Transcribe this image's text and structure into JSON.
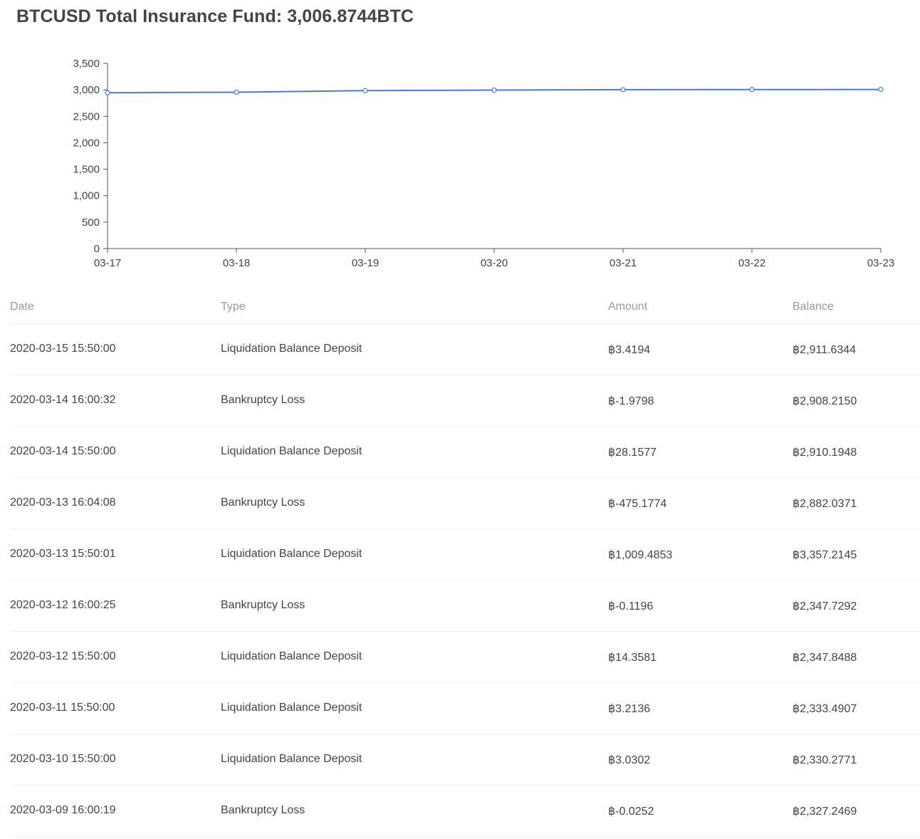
{
  "header": {
    "title": "BTCUSD Total Insurance Fund: 3,006.8744BTC"
  },
  "chart_data": {
    "type": "line",
    "title": "",
    "xlabel": "",
    "ylabel": "",
    "categories": [
      "03-17",
      "03-18",
      "03-19",
      "03-20",
      "03-21",
      "03-22",
      "03-23"
    ],
    "values": [
      2945,
      2955,
      2985,
      2995,
      3003,
      3005,
      3007
    ],
    "yticks": [
      "0",
      "500",
      "1,000",
      "1,500",
      "2,000",
      "2,500",
      "3,000",
      "3,500"
    ],
    "ylim": [
      0,
      3500
    ],
    "grid": false,
    "legend": "none",
    "line_color": "#4a7bd0"
  },
  "table": {
    "columns": [
      "Date",
      "Type",
      "Amount",
      "Balance"
    ],
    "rows": [
      {
        "date": "2020-03-15 15:50:00",
        "type": "Liquidation Balance Deposit",
        "amount": "฿3.4194",
        "balance": "฿2,911.6344"
      },
      {
        "date": "2020-03-14 16:00:32",
        "type": "Bankruptcy Loss",
        "amount": "฿-1.9798",
        "balance": "฿2,908.2150"
      },
      {
        "date": "2020-03-14 15:50:00",
        "type": "Liquidation Balance Deposit",
        "amount": "฿28.1577",
        "balance": "฿2,910.1948"
      },
      {
        "date": "2020-03-13 16:04:08",
        "type": "Bankruptcy Loss",
        "amount": "฿-475.1774",
        "balance": "฿2,882.0371"
      },
      {
        "date": "2020-03-13 15:50:01",
        "type": "Liquidation Balance Deposit",
        "amount": "฿1,009.4853",
        "balance": "฿3,357.2145"
      },
      {
        "date": "2020-03-12 16:00:25",
        "type": "Bankruptcy Loss",
        "amount": "฿-0.1196",
        "balance": "฿2,347.7292"
      },
      {
        "date": "2020-03-12 15:50:00",
        "type": "Liquidation Balance Deposit",
        "amount": "฿14.3581",
        "balance": "฿2,347.8488"
      },
      {
        "date": "2020-03-11 15:50:00",
        "type": "Liquidation Balance Deposit",
        "amount": "฿3.2136",
        "balance": "฿2,333.4907"
      },
      {
        "date": "2020-03-10 15:50:00",
        "type": "Liquidation Balance Deposit",
        "amount": "฿3.0302",
        "balance": "฿2,330.2771"
      },
      {
        "date": "2020-03-09 16:00:19",
        "type": "Bankruptcy Loss",
        "amount": "฿-0.0252",
        "balance": "฿2,327.2469"
      }
    ]
  }
}
